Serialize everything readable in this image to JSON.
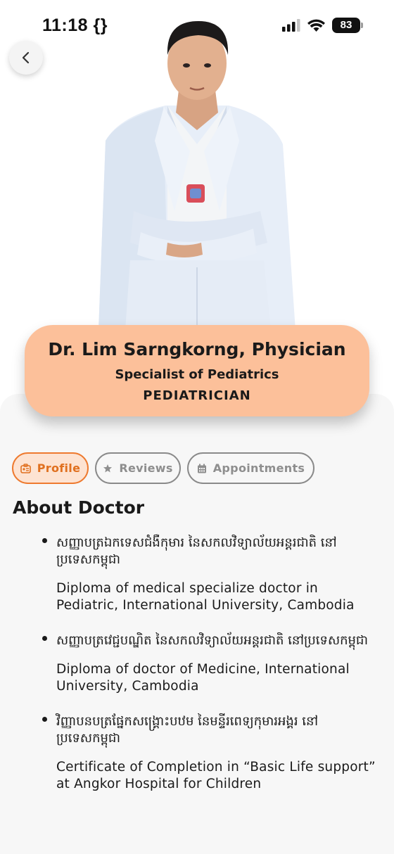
{
  "status_bar": {
    "time": "11:18 {}",
    "battery": "83"
  },
  "doctor": {
    "name": "Dr. Lim Sarngkorng, Physician",
    "specialty": "Specialist of Pediatrics",
    "title": "PEDIATRICIAN"
  },
  "tabs": [
    {
      "label": "Profile",
      "icon": "profile-card-icon",
      "active": true
    },
    {
      "label": "Reviews",
      "icon": "star-icon",
      "active": false
    },
    {
      "label": "Appointments",
      "icon": "calendar-icon",
      "active": false
    }
  ],
  "about": {
    "heading": "About Doctor",
    "qualifications": [
      {
        "khmer": "សញ្ញាបត្រឯកទេសជំងឺកុមារ នៃសកលវិទ្យាល័យអន្តរជាតិ នៅប្រទេសកម្ពុជា",
        "english": "Diploma of medical specialize doctor in Pediatric, International University, Cambodia"
      },
      {
        "khmer": "សញ្ញាបត្រវេជ្ជបណ្ឌិត នៃសកលវិទ្យាល័យអន្តរជាតិ នៅប្រទេសកម្ពុជា",
        "english": "Diploma of doctor of Medicine, International University, Cambodia"
      },
      {
        "khmer": "វិញ្ញាបនបត្រផ្នែកសង្គ្រោះបឋម នៃមន្ទីរពេទ្យកុមារអង្គរ នៅប្រទេសកម្ពុជា",
        "english": "Certificate of Completion in “Basic Life support” at Angkor Hospital for Children"
      }
    ]
  },
  "colors": {
    "accent": "#ee7a2f",
    "card": "#fcc09a",
    "tab_active_bg": "#fde3d2"
  }
}
